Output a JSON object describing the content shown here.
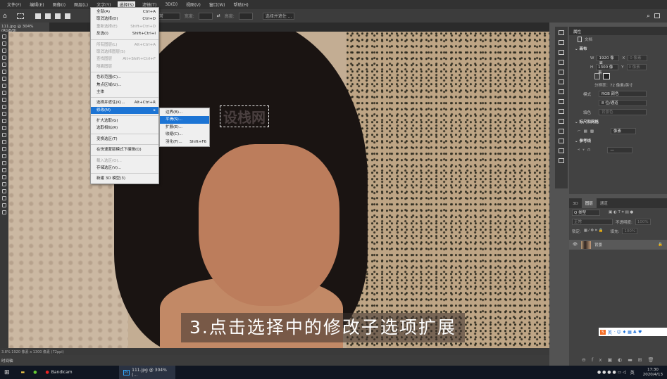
{
  "menubar": [
    "文件(F)",
    "编辑(E)",
    "图像(I)",
    "图层(L)",
    "文字(Y)",
    "选择(S)",
    "滤镜(T)",
    "3D(D)",
    "视图(V)",
    "窗口(W)",
    "帮助(H)"
  ],
  "options": {
    "blend_mode": "正常",
    "width_label": "宽度:",
    "height_label": "高度:",
    "select_mask": "选择并遮住 ..."
  },
  "doc_tab": "111.jpg @ 304%(RGB/8)",
  "select_menu": [
    {
      "label": "全部(A)",
      "shortcut": "Ctrl+A"
    },
    {
      "label": "取消选择(D)",
      "shortcut": "Ctrl+D"
    },
    {
      "label": "重新选择(E)",
      "shortcut": "Shift+Ctrl+D",
      "disabled": true
    },
    {
      "label": "反选(I)",
      "shortcut": "Shift+Ctrl+I"
    },
    {
      "sep": true
    },
    {
      "label": "所有图层(L)",
      "shortcut": "Alt+Ctrl+A",
      "disabled": true
    },
    {
      "label": "取消选择图层(S)",
      "shortcut": "",
      "disabled": true
    },
    {
      "label": "查找图层",
      "shortcut": "Alt+Shift+Ctrl+F",
      "disabled": true
    },
    {
      "label": "隔离图层",
      "shortcut": "",
      "disabled": true
    },
    {
      "sep": true
    },
    {
      "label": "色彩范围(C)...",
      "shortcut": ""
    },
    {
      "label": "焦点区域(U)...",
      "shortcut": ""
    },
    {
      "label": "主体",
      "shortcut": ""
    },
    {
      "sep": true
    },
    {
      "label": "选择并遮住(K)...",
      "shortcut": "Alt+Ctrl+R"
    },
    {
      "label": "修改(M)",
      "shortcut": "▸",
      "highlight": true
    },
    {
      "sep": true
    },
    {
      "label": "扩大选取(G)",
      "shortcut": ""
    },
    {
      "label": "选取相似(R)",
      "shortcut": ""
    },
    {
      "sep": true
    },
    {
      "label": "变换选区(T)",
      "shortcut": ""
    },
    {
      "sep": true
    },
    {
      "label": "在快速蒙版模式下编辑(Q)",
      "shortcut": ""
    },
    {
      "sep": true
    },
    {
      "label": "载入选区(O)...",
      "shortcut": "",
      "disabled": true
    },
    {
      "label": "存储选区(V)...",
      "shortcut": ""
    },
    {
      "sep": true
    },
    {
      "label": "新建 3D 模型(3)",
      "shortcut": ""
    }
  ],
  "modify_submenu": [
    {
      "label": "边界(B)...",
      "shortcut": ""
    },
    {
      "label": "平滑(S)...",
      "shortcut": "",
      "highlight": true
    },
    {
      "label": "扩展(E)...",
      "shortcut": ""
    },
    {
      "label": "收缩(C)...",
      "shortcut": ""
    },
    {
      "label": "羽化(F)...",
      "shortcut": "Shift+F6"
    }
  ],
  "canvas": {
    "watermark": "设栈网",
    "caption": "3.点击选择中的修改子选项扩展"
  },
  "properties": {
    "tab": "属性",
    "doc": "文档",
    "canvas_section": "画布",
    "w_label": "W",
    "w": "1920 像素",
    "h_label": "H",
    "h": "1300 像素",
    "x_label": "X",
    "x": "0 像素",
    "y_label": "Y",
    "y": "0 像素",
    "resolution": "分辨率：72 像素/英寸",
    "mode_label": "模式",
    "mode": "RGB 颜色",
    "depth": "8 位/通道",
    "fill_label": "填色",
    "fill": "背景色",
    "rulers_section": "标尺和网格",
    "units": "像素",
    "guides_section": "参考线"
  },
  "layers": {
    "tabs": [
      "3D",
      "图层",
      "通道"
    ],
    "filter": "Q 类型",
    "blend": "正常",
    "opacity_label": "不透明度:",
    "opacity": "100%",
    "lock_label": "锁定:",
    "fill_label": "填充:",
    "fill": "100%",
    "layer_name": "背景"
  },
  "ime": "英",
  "status": "3.8%    1920 像素 x 1300 像素 (72ppi)",
  "timeline": "时间轴",
  "taskbar": {
    "apps": [
      "Bandicam",
      "111.jpg @ 304%(..."
    ],
    "time": "17:30",
    "date": "2020/4/13",
    "ime": "英"
  }
}
